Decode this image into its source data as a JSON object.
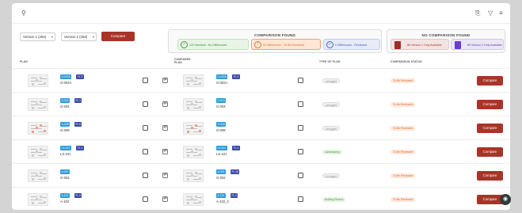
{
  "topbar": {
    "search_icon": "search-icon",
    "clip_icon": "paperclip-icon",
    "filter_icon": "filter-icon",
    "sort_icon": "sort-icon"
  },
  "controls": {
    "version1": "Version 1 (266)",
    "version2": "Version 2 (268)",
    "compare_label": "Compare"
  },
  "comparison_found": {
    "title": "COMPARISON FOUND",
    "identical": "120 Identical - No Differences",
    "to_be_reviewed": "53 Differences - To Be Reviewed",
    "reviewed": "0 Differences - Reviewed"
  },
  "no_comparison_found": {
    "title": "NO COMPARISON FOUND",
    "v1_only": "86 Version 1 Only Available",
    "v2_only": "89 Version 2 Only Available"
  },
  "headers": {
    "plan": "PLAN",
    "compared_plan": "COMPARED PLAN",
    "type_of_plan": "TYPE OF PLAN",
    "comparison_status": "COMPARISON STATUS"
  },
  "rows": [
    {
      "left_tags": [
        "G-002A",
        "FL 3"
      ],
      "left_code": "G-002A",
      "right_tags": [
        "G-002A",
        "FL 3"
      ],
      "right_code": "G-002A",
      "type": "Unlogged",
      "status": "To Be Reviewed",
      "compare": "Compare"
    },
    {
      "left_tags": [
        "G-004",
        "FL 1"
      ],
      "left_code": "G-004",
      "right_tags": [
        "G-004"
      ],
      "right_code": "G-004",
      "type": "Unlogged",
      "status": "To Be Reviewed",
      "compare": "Compare"
    },
    {
      "left_tags": [
        "G-008",
        "FL 6"
      ],
      "left_code": "G-008",
      "right_tags": [
        "G-008"
      ],
      "right_code": "G-008",
      "type": "Unlogged",
      "status": "To Be Reviewed",
      "compare": "Compare"
    },
    {
      "left_tags": [
        "LS-101",
        "FL 4"
      ],
      "left_code": "LS-101",
      "right_tags": [
        "LS-101",
        "FL 4"
      ],
      "right_code": "LS-101",
      "type": "Landscaping",
      "status": "To Be Reviewed",
      "compare": "Compare"
    },
    {
      "left_tags": [
        "A-002"
      ],
      "left_code": "G-002",
      "right_tags": [
        "A-002",
        "FL 30"
      ],
      "right_code": "G-002",
      "type": "Unlogged",
      "status": "To Be Reviewed",
      "compare": "Compare"
    },
    {
      "left_tags": [
        "A-102",
        "FL 2"
      ],
      "left_code": "A-102",
      "right_tags": [
        "A-102",
        "FL 2"
      ],
      "right_code": "A-102_C",
      "type": "Building Review",
      "status": "To Be Reviewed",
      "compare": "Compare"
    }
  ]
}
